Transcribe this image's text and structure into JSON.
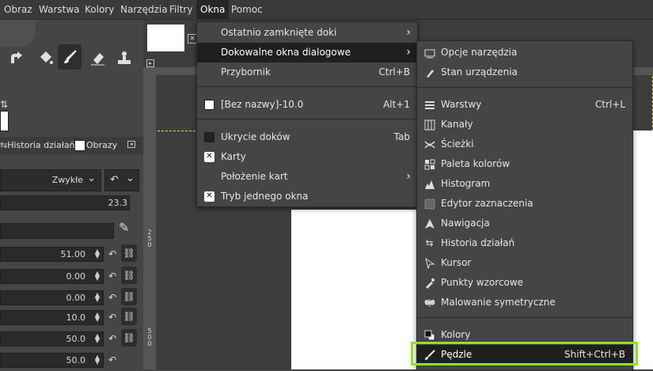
{
  "menubar": {
    "items": [
      "Obraz",
      "Warstwa",
      "Kolory",
      "Narzędzia",
      "Filtry",
      "Okna",
      "Pomoc"
    ],
    "active": "Okna"
  },
  "toolbox": {
    "tabs": {
      "undo_history": "Historia działań",
      "images": "Obrazy"
    },
    "mode": "Zwykłe",
    "values": {
      "opacity": "23.3",
      "size": "51.00",
      "aspect": "0.00",
      "angle": "0.00",
      "spacing": "10.0",
      "hardness": "50.0",
      "force": "50.0"
    }
  },
  "rulers": {
    "v_labels": [
      "2",
      "5",
      "0",
      "5",
      "0",
      "0"
    ],
    "h_labels": []
  },
  "okna_menu": {
    "items": [
      {
        "label": "Ostatnio zamknięte doki",
        "submenu": true
      },
      {
        "label": "Dokowalne okna dialogowe",
        "submenu": true,
        "highlighted": true
      },
      {
        "label": "Przybornik",
        "accel": "Ctrl+B"
      },
      {
        "label": "[Bez nazwy]-10.0",
        "accel": "Alt+1",
        "icon": "white-square"
      },
      {
        "label": "Ukrycie doków",
        "accel": "Tab",
        "check": false
      },
      {
        "label": "Karty",
        "check": true
      },
      {
        "label": "Położenie kart",
        "submenu": true
      },
      {
        "label": "Tryb jednego okna",
        "check": true
      }
    ]
  },
  "dockable_menu": {
    "items": [
      {
        "label": "Opcje narzędzia",
        "icon": "tool-options-icon"
      },
      {
        "label": "Stan urządzenia",
        "icon": "device-status-icon"
      },
      {
        "label": "Warstwy",
        "accel": "Ctrl+L",
        "icon": "layers-icon"
      },
      {
        "label": "Kanały",
        "icon": "channels-icon"
      },
      {
        "label": "Ścieżki",
        "icon": "paths-icon"
      },
      {
        "label": "Paleta kolorów",
        "icon": "palette-icon"
      },
      {
        "label": "Histogram",
        "icon": "histogram-icon"
      },
      {
        "label": "Edytor zaznaczenia",
        "icon": "selection-editor-icon"
      },
      {
        "label": "Nawigacja",
        "icon": "navigation-icon"
      },
      {
        "label": "Historia działań",
        "icon": "undo-history-icon"
      },
      {
        "label": "Kursor",
        "icon": "pointer-icon"
      },
      {
        "label": "Punkty wzorcowe",
        "icon": "sample-points-icon"
      },
      {
        "label": "Malowanie symetryczne",
        "icon": "symmetry-icon"
      },
      {
        "label": "Kolory",
        "icon": "colors-icon"
      },
      {
        "label": "Pędzle",
        "accel": "Shift+Ctrl+B",
        "icon": "brush-icon",
        "highlighted": true
      }
    ]
  },
  "colors": {
    "highlight_outline": "#8de31f",
    "menu_bg": "#454545",
    "hl_bg": "#1f1f1f"
  }
}
